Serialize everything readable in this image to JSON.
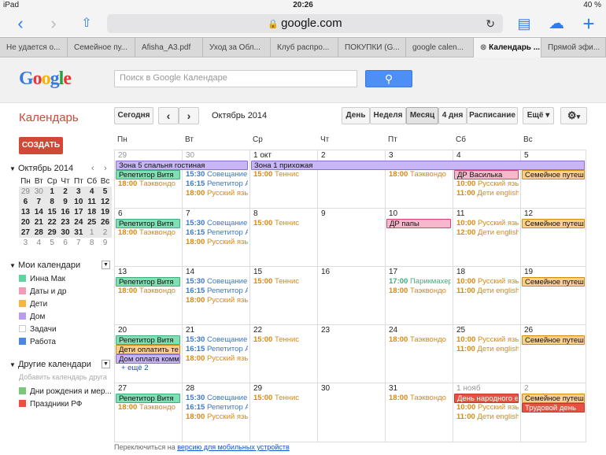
{
  "status": {
    "device": "iPad",
    "time": "20:26",
    "battery": "40 %"
  },
  "browser": {
    "url": "google.com"
  },
  "tabs": [
    "Не удается о...",
    "Семейное пу...",
    "Afisha_A3.pdf",
    "Уход за Обл...",
    "Клуб распро...",
    "ПОКУПКИ (G...",
    "google calen...",
    "Календарь ...",
    "Прямой эфи..."
  ],
  "header": {
    "logo": "Google",
    "search_placeholder": "Поиск в Google Календаре"
  },
  "app": {
    "title": "Календарь",
    "create": "СОЗДАТЬ",
    "today": "Сегодня",
    "period": "Октябрь 2014",
    "views": [
      "День",
      "Неделя",
      "Месяц",
      "4 дня",
      "Расписание"
    ],
    "more": "Ещё"
  },
  "mini": {
    "title": "Октябрь 2014",
    "heads": [
      "Пн",
      "Вт",
      "Ср",
      "Чт",
      "Пт",
      "Сб",
      "Вс"
    ],
    "weeks": [
      [
        "29",
        "30",
        "1",
        "2",
        "3",
        "4",
        "5"
      ],
      [
        "6",
        "7",
        "8",
        "9",
        "10",
        "11",
        "12"
      ],
      [
        "13",
        "14",
        "15",
        "16",
        "17",
        "18",
        "19"
      ],
      [
        "20",
        "21",
        "22",
        "23",
        "24",
        "25",
        "26"
      ],
      [
        "27",
        "28",
        "29",
        "30",
        "31",
        "1",
        "2"
      ],
      [
        "3",
        "4",
        "5",
        "6",
        "7",
        "8",
        "9"
      ]
    ]
  },
  "my_calendars": {
    "title": "Мои календари",
    "items": [
      {
        "name": "Инна Мак",
        "color": "#5fd4a0"
      },
      {
        "name": "Даты и др",
        "color": "#f49ab8"
      },
      {
        "name": "Дети",
        "color": "#f7b548"
      },
      {
        "name": "Дом",
        "color": "#b99bf0"
      },
      {
        "name": "Задачи",
        "color": "#ffffff"
      },
      {
        "name": "Работа",
        "color": "#4987e0"
      }
    ]
  },
  "other_calendars": {
    "title": "Другие календари",
    "placeholder": "Добавить календарь друга",
    "items": [
      {
        "name": "Дни рождения и мер...",
        "color": "#7bc67b"
      },
      {
        "name": "Праздники РФ",
        "color": "#e8503f"
      }
    ]
  },
  "grid": {
    "headers": [
      "Пн",
      "Вт",
      "Ср",
      "Чт",
      "Пт",
      "Сб",
      "Вс"
    ],
    "weeks": [
      {
        "days": [
          "29",
          "30",
          "1 окт",
          "2",
          "3",
          "4",
          "5"
        ],
        "other": [
          true,
          true,
          false,
          false,
          false,
          false,
          false
        ]
      },
      {
        "days": [
          "6",
          "7",
          "8",
          "9",
          "10",
          "11",
          "12"
        ],
        "other": [
          false,
          false,
          false,
          false,
          false,
          false,
          false
        ]
      },
      {
        "days": [
          "13",
          "14",
          "15",
          "16",
          "17",
          "18",
          "19"
        ],
        "other": [
          false,
          false,
          false,
          false,
          false,
          false,
          false
        ]
      },
      {
        "days": [
          "20",
          "21",
          "22",
          "23",
          "24",
          "25",
          "26"
        ],
        "other": [
          false,
          false,
          false,
          false,
          false,
          false,
          false
        ]
      },
      {
        "days": [
          "27",
          "28",
          "29",
          "30",
          "31",
          "1 нояб",
          "2"
        ],
        "other": [
          false,
          false,
          false,
          false,
          false,
          true,
          true
        ]
      }
    ],
    "events": [
      {
        "w": 0,
        "d": 0,
        "span": 2,
        "row": 0,
        "text": "Зона 5 спальня гостиная",
        "type": "bar",
        "bg": "#c8b6f4",
        "bd": "#8a6fd8"
      },
      {
        "w": 0,
        "d": 2,
        "span": 5,
        "row": 0,
        "text": "Зона 1 прихожая",
        "type": "bar",
        "bg": "#c8b6f4",
        "bd": "#8a6fd8"
      },
      {
        "w": 0,
        "d": 0,
        "row": 1,
        "text": "Репетитор Витя",
        "type": "bar",
        "bg": "#7fe0b6",
        "bd": "#3fb07a"
      },
      {
        "w": 0,
        "d": 0,
        "row": 2,
        "time": "18:00",
        "text": "Таэквондо",
        "color": "#d68a12"
      },
      {
        "w": 0,
        "d": 1,
        "row": 1,
        "time": "15:30",
        "text": "Совещание",
        "color": "#3d77c9"
      },
      {
        "w": 0,
        "d": 1,
        "row": 2,
        "time": "16:15",
        "text": "Репетитор А",
        "color": "#3d77c9"
      },
      {
        "w": 0,
        "d": 1,
        "row": 3,
        "time": "18:00",
        "text": "Русский язы",
        "color": "#d68a12"
      },
      {
        "w": 0,
        "d": 2,
        "row": 1,
        "time": "15:00",
        "text": "Теннис",
        "color": "#d68a12"
      },
      {
        "w": 0,
        "d": 4,
        "row": 1,
        "time": "18:00",
        "text": "Таэквондо",
        "color": "#d68a12"
      },
      {
        "w": 0,
        "d": 5,
        "row": 1,
        "text": "ДР Василька",
        "type": "bar",
        "bg": "#f7b7cd",
        "bd": "#d9436e"
      },
      {
        "w": 0,
        "d": 5,
        "row": 2,
        "time": "10:00",
        "text": "Русский язы",
        "color": "#d68a12"
      },
      {
        "w": 0,
        "d": 5,
        "row": 3,
        "time": "11:00",
        "text": "Дети english",
        "color": "#d68a12"
      },
      {
        "w": 0,
        "d": 6,
        "row": 1,
        "text": "Семейное путешес",
        "type": "bar",
        "bg": "#fbd08a",
        "bd": "#d68a12"
      },
      {
        "w": 1,
        "d": 0,
        "row": 0,
        "text": "Репетитор Витя",
        "type": "bar",
        "bg": "#7fe0b6",
        "bd": "#3fb07a"
      },
      {
        "w": 1,
        "d": 0,
        "row": 1,
        "time": "18:00",
        "text": "Таэквондо",
        "color": "#d68a12"
      },
      {
        "w": 1,
        "d": 1,
        "row": 0,
        "time": "15:30",
        "text": "Совещание",
        "color": "#3d77c9"
      },
      {
        "w": 1,
        "d": 1,
        "row": 1,
        "time": "16:15",
        "text": "Репетитор А",
        "color": "#3d77c9"
      },
      {
        "w": 1,
        "d": 1,
        "row": 2,
        "time": "18:00",
        "text": "Русский язы",
        "color": "#d68a12"
      },
      {
        "w": 1,
        "d": 2,
        "row": 0,
        "time": "15:00",
        "text": "Теннис",
        "color": "#d68a12"
      },
      {
        "w": 1,
        "d": 4,
        "row": 0,
        "text": "ДР папы",
        "type": "bar",
        "bg": "#f7b7cd",
        "bd": "#d9436e"
      },
      {
        "w": 1,
        "d": 5,
        "row": 0,
        "time": "10:00",
        "text": "Русский язы",
        "color": "#d68a12"
      },
      {
        "w": 1,
        "d": 5,
        "row": 1,
        "time": "12:00",
        "text": "Дети english",
        "color": "#d68a12"
      },
      {
        "w": 1,
        "d": 6,
        "row": 0,
        "text": "Семейное путешес",
        "type": "bar",
        "bg": "#fbd08a",
        "bd": "#d68a12"
      },
      {
        "w": 2,
        "d": 0,
        "row": 0,
        "text": "Репетитор Витя",
        "type": "bar",
        "bg": "#7fe0b6",
        "bd": "#3fb07a"
      },
      {
        "w": 2,
        "d": 0,
        "row": 1,
        "time": "18:00",
        "text": "Таэквондо",
        "color": "#d68a12"
      },
      {
        "w": 2,
        "d": 1,
        "row": 0,
        "time": "15:30",
        "text": "Совещание",
        "color": "#3d77c9"
      },
      {
        "w": 2,
        "d": 1,
        "row": 1,
        "time": "16:15",
        "text": "Репетитор А",
        "color": "#3d77c9"
      },
      {
        "w": 2,
        "d": 1,
        "row": 2,
        "time": "18:00",
        "text": "Русский язы",
        "color": "#d68a12"
      },
      {
        "w": 2,
        "d": 2,
        "row": 0,
        "time": "15:00",
        "text": "Теннис",
        "color": "#d68a12"
      },
      {
        "w": 2,
        "d": 4,
        "row": 0,
        "time": "17:00",
        "text": "Парикмахер",
        "color": "#3fb07a"
      },
      {
        "w": 2,
        "d": 4,
        "row": 1,
        "time": "18:00",
        "text": "Таэквондо",
        "color": "#d68a12"
      },
      {
        "w": 2,
        "d": 5,
        "row": 0,
        "time": "10:00",
        "text": "Русский язы",
        "color": "#d68a12"
      },
      {
        "w": 2,
        "d": 5,
        "row": 1,
        "time": "11:00",
        "text": "Дети english",
        "color": "#d68a12"
      },
      {
        "w": 2,
        "d": 6,
        "row": 0,
        "text": "Семейное путешес",
        "type": "bar",
        "bg": "#fbd08a",
        "bd": "#d68a12"
      },
      {
        "w": 3,
        "d": 0,
        "row": 0,
        "text": "Репетитор Витя",
        "type": "bar",
        "bg": "#7fe0b6",
        "bd": "#3fb07a"
      },
      {
        "w": 3,
        "d": 0,
        "row": 1,
        "text": "Дети оплатить те",
        "type": "bar",
        "bg": "#fbd08a",
        "bd": "#d68a12"
      },
      {
        "w": 3,
        "d": 0,
        "row": 2,
        "text": "Дом оплата комм",
        "type": "bar",
        "bg": "#c8b6f4",
        "bd": "#8a6fd8"
      },
      {
        "w": 3,
        "d": 0,
        "row": 3,
        "text": "+ ещё 2",
        "color": "#15c",
        "more": true
      },
      {
        "w": 3,
        "d": 1,
        "row": 0,
        "time": "15:30",
        "text": "Совещание",
        "color": "#3d77c9"
      },
      {
        "w": 3,
        "d": 1,
        "row": 1,
        "time": "16:15",
        "text": "Репетитор А",
        "color": "#3d77c9"
      },
      {
        "w": 3,
        "d": 1,
        "row": 2,
        "time": "18:00",
        "text": "Русский язы",
        "color": "#d68a12"
      },
      {
        "w": 3,
        "d": 2,
        "row": 0,
        "time": "15:00",
        "text": "Теннис",
        "color": "#d68a12"
      },
      {
        "w": 3,
        "d": 4,
        "row": 0,
        "time": "18:00",
        "text": "Таэквондо",
        "color": "#d68a12"
      },
      {
        "w": 3,
        "d": 5,
        "row": 0,
        "time": "10:00",
        "text": "Русский язы",
        "color": "#d68a12"
      },
      {
        "w": 3,
        "d": 5,
        "row": 1,
        "time": "11:00",
        "text": "Дети english",
        "color": "#d68a12"
      },
      {
        "w": 3,
        "d": 6,
        "row": 0,
        "text": "Семейное путешес",
        "type": "bar",
        "bg": "#fbd08a",
        "bd": "#d68a12"
      },
      {
        "w": 4,
        "d": 0,
        "row": 0,
        "text": "Репетитор Витя",
        "type": "bar",
        "bg": "#7fe0b6",
        "bd": "#3fb07a"
      },
      {
        "w": 4,
        "d": 0,
        "row": 1,
        "time": "18:00",
        "text": "Таэквондо",
        "color": "#d68a12"
      },
      {
        "w": 4,
        "d": 1,
        "row": 0,
        "time": "15:30",
        "text": "Совещание",
        "color": "#3d77c9"
      },
      {
        "w": 4,
        "d": 1,
        "row": 1,
        "time": "16:15",
        "text": "Репетитор А",
        "color": "#3d77c9"
      },
      {
        "w": 4,
        "d": 1,
        "row": 2,
        "time": "18:00",
        "text": "Русский язы",
        "color": "#d68a12"
      },
      {
        "w": 4,
        "d": 2,
        "row": 0,
        "time": "15:00",
        "text": "Теннис",
        "color": "#d68a12"
      },
      {
        "w": 4,
        "d": 4,
        "row": 0,
        "time": "18:00",
        "text": "Таэквондо",
        "color": "#d68a12"
      },
      {
        "w": 4,
        "d": 5,
        "row": 0,
        "text": "День народного е",
        "type": "bar",
        "bg": "#e8503f",
        "bd": "#c0392b",
        "fg": "#fff"
      },
      {
        "w": 4,
        "d": 5,
        "row": 1,
        "time": "10:00",
        "text": "Русский язы",
        "color": "#d68a12"
      },
      {
        "w": 4,
        "d": 5,
        "row": 2,
        "time": "11:00",
        "text": "Дети english",
        "color": "#d68a12"
      },
      {
        "w": 4,
        "d": 6,
        "row": 0,
        "text": "Семейное путешес",
        "type": "bar",
        "bg": "#fbd08a",
        "bd": "#d68a12"
      },
      {
        "w": 4,
        "d": 6,
        "row": 1,
        "text": "Трудовой день",
        "type": "bar",
        "bg": "#e8503f",
        "bd": "#c0392b",
        "fg": "#fff"
      }
    ]
  },
  "footer": {
    "text": "Переключиться на",
    "link": "версию для мобильных устройств"
  }
}
